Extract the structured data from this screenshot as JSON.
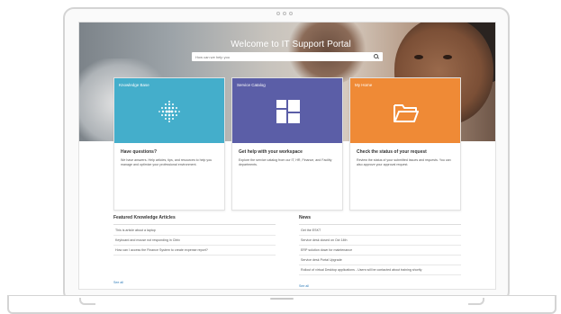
{
  "portal": {
    "title": "Welcome to IT Support Portal",
    "search_placeholder": "How can we help you"
  },
  "cards": [
    {
      "label": "Knowledge Base",
      "heading": "Have questions?",
      "description": "We have answers. Help articles, tips, and resources to help you manage and optimize your professional environment.",
      "color": "#44aecb",
      "icon": "dots-sphere-icon"
    },
    {
      "label": "Service Catalog",
      "heading": "Get help with your workspace",
      "description": "Explore the service catalog from our IT, HR, Finance, and Facility departments.",
      "color": "#5b5ea7",
      "icon": "catalog-grid-icon"
    },
    {
      "label": "My Home",
      "heading": "Check the status of your request",
      "description": "Review the status of your submitted issues and requests. You can also approve your approval request.",
      "color": "#ef8a36",
      "icon": "folder-icon"
    }
  ],
  "knowledge": {
    "title": "Featured Knowledge Articles",
    "items": [
      "This is article about a laptop",
      "Keyboard and mouse not responding in Citrix",
      "How can I access the Finance System to create expense report?"
    ],
    "see_all": "See all"
  },
  "news": {
    "title": "News",
    "items": [
      "Get the ESKT",
      "Service desk closed on Oct 14th",
      "ERP solution down for maintenance",
      "Service desk Portal Upgrade",
      "Rollout of virtual Desktop applications - Users will be contacted about training shortly"
    ],
    "see_all": "See all"
  }
}
